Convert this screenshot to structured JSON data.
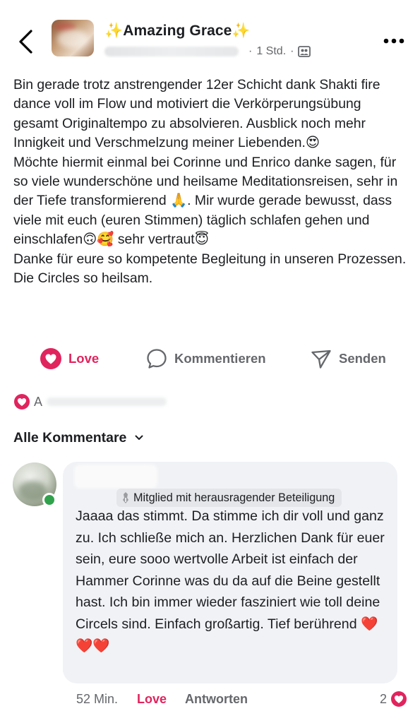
{
  "header": {
    "group_name": "✨Amazing Grace✨",
    "time": "1 Std.",
    "separator": "·",
    "icons": {
      "back": "chevron-left-icon",
      "privacy": "group-members-icon",
      "more": "more-dots-icon"
    }
  },
  "post": {
    "paragraphs": [
      "Bin gerade trotz anstrengender 12er Schicht dank Shakti fire dance voll im Flow und motiviert die Verkörperungsübung gesamt Originaltempo zu absolvieren. Ausblick noch mehr Innigkeit und Verschmelzung meiner Liebenden.😍",
      "Möchte hiermit einmal bei Corinne und Enrico danke sagen, für so viele wunderschöne  und heilsame Meditationsreisen, sehr in der Tiefe transformierend 🙏. Mir wurde gerade bewusst, dass viele mit euch (euren Stimmen)  täglich schlafen gehen und einschlafen🙃🥰 sehr vertraut😇",
      "Danke für eure so kompetente Begleitung in unseren Prozessen. Die Circles so heilsam."
    ]
  },
  "actions": {
    "love_label": "Love",
    "comment_label": "Kommentieren",
    "send_label": "Senden",
    "love_color": "#e0245e"
  },
  "reactions_summary": {
    "partial_name": "A"
  },
  "comments_filter": {
    "label": "Alle Kommentare"
  },
  "comment": {
    "badge": "Mitglied mit herausragender Beteiligung",
    "text": "Jaaaa das stimmt. Da stimme ich dir voll und ganz zu. Ich schließe mich an. Herzlichen Dank für euer sein, eure sooo wertvolle Arbeit ist einfach der Hammer Corinne was du da auf die Beine gestellt hast. Ich bin immer wieder fasziniert wie toll deine Circels sind. Einfach großartig. Tief berührend ❤️❤️❤️",
    "time": "52 Min.",
    "love_label": "Love",
    "reply_label": "Antworten",
    "reaction_count": "2",
    "online_color": "#31a24c"
  }
}
